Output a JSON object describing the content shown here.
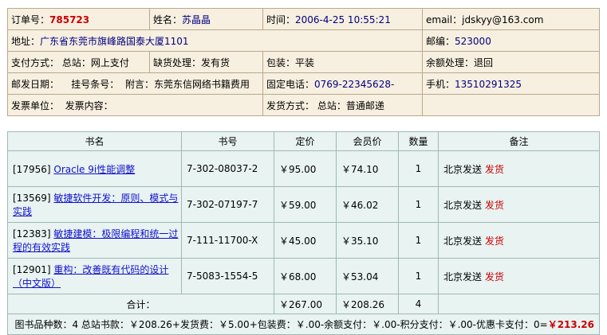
{
  "order": {
    "order_no_label": "订单号：",
    "order_no": "785723",
    "name_label": "姓名：",
    "name": "苏晶晶",
    "time_label": "时间：",
    "time": "2006-4-25 10:55:21",
    "email_label": "email：",
    "email": "jdskyy@163.com",
    "address_label": "地址：",
    "address": "广东省东莞市旗峰路国泰大厦1101",
    "postcode_label": "邮编：",
    "postcode": "523000",
    "payment": "支付方式：  总站：网上支付",
    "shortage": "缺货处理：发有货",
    "packing": "包装：平装",
    "balance": "余额处理：退回",
    "post_date": "邮发日期：",
    "registered": "挂号条号：",
    "note": "附言：东莞东信网络书籍费用",
    "phone_label": "固定电话：",
    "phone": "0769-22345628-",
    "mobile_label": "手机：",
    "mobile": "13510291325",
    "invoice_unit": "发票单位：",
    "invoice_content": "发票内容：",
    "shipping": "发货方式：  总站：普通邮递"
  },
  "books": {
    "headers": [
      "书名",
      "书号",
      "定价",
      "会员价",
      "数量",
      "备注"
    ],
    "rows": [
      {
        "id": "[17956]",
        "title": "Oracle 9i性能调整",
        "isbn": "7-302-08037-2",
        "price": "￥95.00",
        "member_price": "￥74.10",
        "qty": "1",
        "remark": "北京发送",
        "status": "发货"
      },
      {
        "id": "[13569]",
        "title": "敏捷软件开发：原则、模式与实践",
        "isbn": "7-302-07197-7",
        "price": "￥59.00",
        "member_price": "￥46.02",
        "qty": "1",
        "remark": "北京发送",
        "status": "发货"
      },
      {
        "id": "[12383]",
        "title": "敏捷建模：极限编程和统一过程的有效实践",
        "isbn": "7-111-11700-X",
        "price": "￥45.00",
        "member_price": "￥35.10",
        "qty": "1",
        "remark": "北京发送",
        "status": "发货"
      },
      {
        "id": "[12901]",
        "title": "重构：改善既有代码的设计（中文版）",
        "isbn": "7-5083-1554-5",
        "price": "￥68.00",
        "member_price": "￥53.04",
        "qty": "1",
        "remark": "北京发送",
        "status": "发货"
      }
    ],
    "total_label": "合计：",
    "total_price": "￥267.00",
    "total_member": "￥208.26",
    "total_qty": "4",
    "summary": "图书品种数：4 总站书款：￥208.26+发货费：￥5.00+包装费：￥.00-余额支付：￥.00-积分支付：￥.00-优惠卡支付：0=",
    "grand_total": "￥213.26"
  },
  "colors": {
    "order_bg": "#f7efdf",
    "books_bg": "#e8f3f2",
    "accent_red": "#cc0000",
    "link_blue": "#1111cc"
  }
}
